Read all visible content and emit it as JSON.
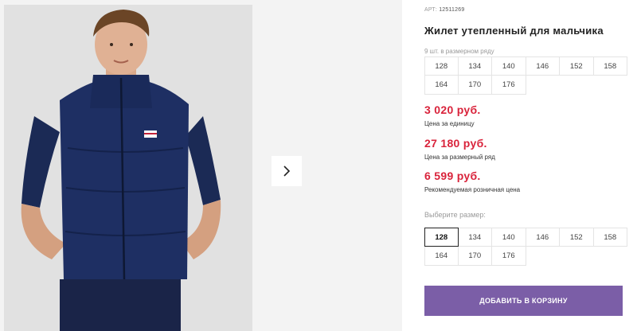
{
  "product": {
    "art_label": "АРТ:",
    "art_number": "12511269",
    "title": "Жилет утепленный для мальчика",
    "row_count_text": "9 шт. в размерном ряду",
    "row_sizes": [
      "128",
      "134",
      "140",
      "146",
      "152",
      "158",
      "164",
      "170",
      "176"
    ]
  },
  "prices": [
    {
      "value": "3 020 руб.",
      "label": "Цена за единицу"
    },
    {
      "value": "27 180 руб.",
      "label": "Цена за размерный ряд"
    },
    {
      "value": "6 599 руб.",
      "label": "Рекомендуемая розничная цена"
    }
  ],
  "size_selector": {
    "label": "Выберите размер:",
    "options": [
      "128",
      "134",
      "140",
      "146",
      "152",
      "158",
      "164",
      "170",
      "176"
    ],
    "selected": "128"
  },
  "cart": {
    "button_label": "ДОБАВИТЬ В КОРЗИНУ"
  },
  "gallery": {
    "next_icon": "chevron-right-icon"
  },
  "colors": {
    "price_red": "#d9233b",
    "button_purple": "#7b5ea7",
    "vest_navy": "#1e2f63"
  }
}
